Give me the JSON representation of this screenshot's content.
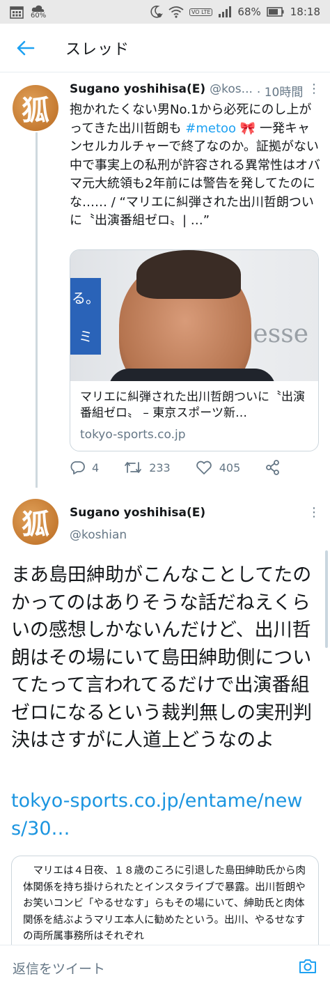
{
  "status_bar": {
    "network_label": "60%",
    "battery": "68%",
    "time": "18:18",
    "lte_label": "VO LTE",
    "icons": [
      "calendar-icon",
      "weather-icon",
      "dnd-moon-icon",
      "wifi-icon",
      "signal-icon",
      "battery-icon"
    ]
  },
  "header": {
    "title": "スレッド",
    "back_icon": "arrow-left-icon"
  },
  "thread_tweet": {
    "avatar_char": "狐",
    "display_name": "Sugano yoshihisa(E)",
    "handle": "@kos...",
    "time": "· 10時間",
    "text_before_tag": "抱かれたくない男No.1から必死にのし上がってきた出川哲朗も ",
    "hashtag": "#metoo",
    "emoji": "🎀",
    "text_after_tag": " 一発キャンセルカルチャーで終了なのか。証拠がない中で事実上の私刑が許容される異常性はオバマ元大統領も2年前には警告を発してたのにな…… / “マリエに糾弾された出川哲朗ついに〝出演番組ゼロ〟| …”",
    "card": {
      "image_sign_chars": [
        "る。",
        "ミ"
      ],
      "image_bg_text": "esse",
      "title": "マリエに糾弾された出川哲朗ついに〝出演番組ゼロ〟 – 東京スポーツ新…",
      "domain": "tokyo-sports.co.jp"
    },
    "actions": {
      "replies": "4",
      "retweets": "233",
      "likes": "405"
    }
  },
  "main_tweet": {
    "avatar_char": "狐",
    "display_name": "Sugano yoshihisa(E)",
    "handle": "@koshian",
    "text": "まあ島田紳助がこんなことしてたのかってのはありそうな話だねえくらいの感想しかないんだけど、出川哲朗はその場にいて島田紳助側についてたって言われてるだけで出演番組ゼロになるという裁判無しの実刑判決はさすがに人道上どうなのよ",
    "link": "tokyo-sports.co.jp/entame/news/30…",
    "quote": "マリエは４日夜、１８歳のころに引退した島田紳助氏から肉体関係を持ち掛けられたとインスタライブで暴露。出川哲朗やお笑いコンビ「やるせなす」らもその場にいて、紳助氏と肉体関係を結ぶようマリエ本人に勧めたという。出川、やるせなすの両所属事務所はそれぞれ"
  },
  "reply_bar": {
    "placeholder": "返信をツイート",
    "camera_icon": "camera-icon"
  },
  "colors": {
    "accent": "#1da1f2",
    "link": "#1b95e0",
    "muted": "#657786",
    "border": "#e6ecf0",
    "avatar": "#c57a31"
  }
}
